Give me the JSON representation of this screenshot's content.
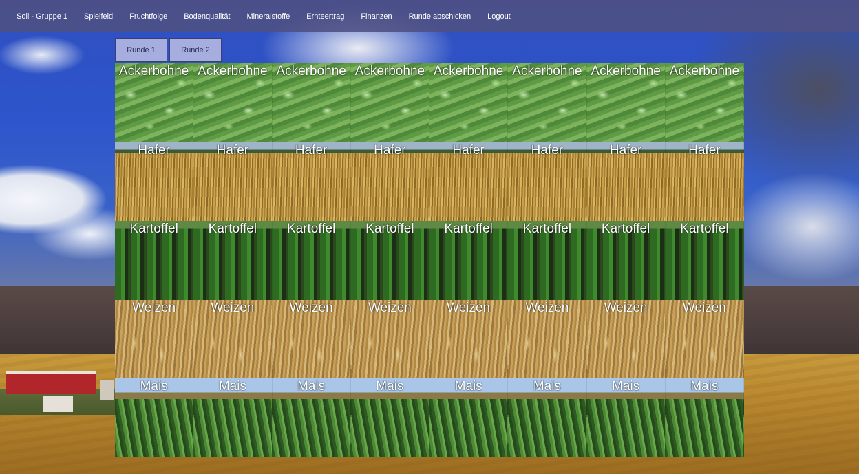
{
  "nav": {
    "items": [
      {
        "label": "Soil - Gruppe 1"
      },
      {
        "label": "Spielfeld"
      },
      {
        "label": "Fruchtfolge"
      },
      {
        "label": "Bodenqualität"
      },
      {
        "label": "Mineralstoffe"
      },
      {
        "label": "Ernteertrag"
      },
      {
        "label": "Finanzen"
      },
      {
        "label": "Runde abschicken"
      },
      {
        "label": "Logout"
      }
    ]
  },
  "tabs": [
    {
      "label": "Runde 1"
    },
    {
      "label": "Runde 2"
    }
  ],
  "grid": {
    "rows": [
      {
        "crop": "Ackerbohne",
        "cells": [
          "Ackerbohne",
          "Ackerbohne",
          "Ackerbohne",
          "Ackerbohne",
          "Ackerbohne",
          "Ackerbohne",
          "Ackerbohne",
          "Ackerbohne"
        ]
      },
      {
        "crop": "Hafer",
        "cells": [
          "Hafer",
          "Hafer",
          "Hafer",
          "Hafer",
          "Hafer",
          "Hafer",
          "Hafer",
          "Hafer"
        ]
      },
      {
        "crop": "Kartoffel",
        "cells": [
          "Kartoffel",
          "Kartoffel",
          "Kartoffel",
          "Kartoffel",
          "Kartoffel",
          "Kartoffel",
          "Kartoffel",
          "Kartoffel"
        ]
      },
      {
        "crop": "Weizen",
        "cells": [
          "Weizen",
          "Weizen",
          "Weizen",
          "Weizen",
          "Weizen",
          "Weizen",
          "Weizen",
          "Weizen"
        ]
      },
      {
        "crop": "Mais",
        "cells": [
          "Mais",
          "Mais",
          "Mais",
          "Mais",
          "Mais",
          "Mais",
          "Mais",
          "Mais"
        ]
      }
    ]
  }
}
